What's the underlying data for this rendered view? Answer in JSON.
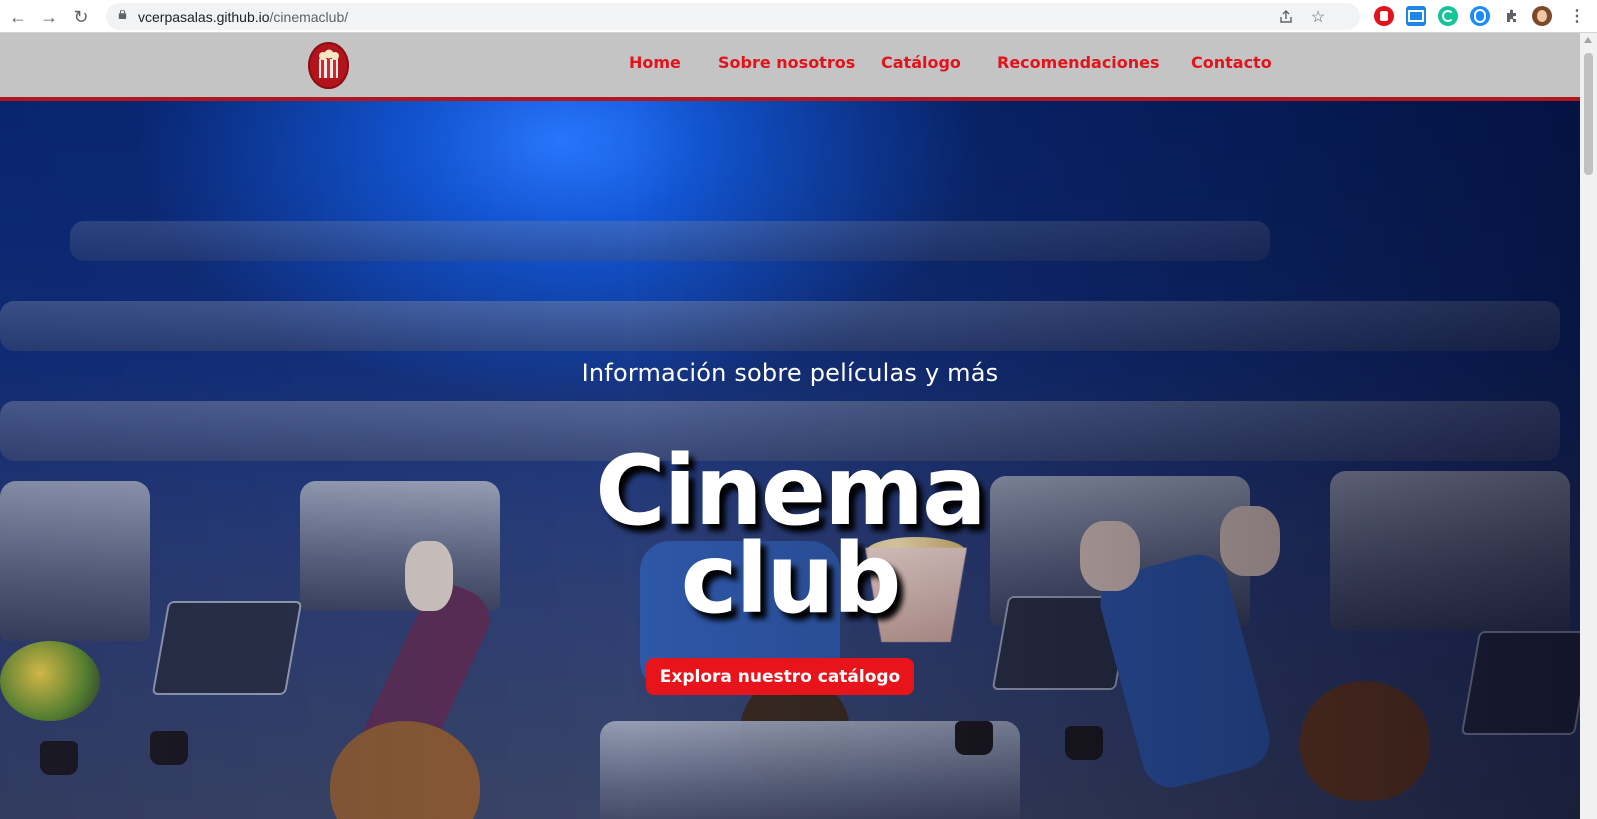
{
  "browser": {
    "url_host": "vcerpasalas.github.io",
    "url_path": "/cinemaclub/"
  },
  "site": {
    "nav": [
      {
        "label": "Home"
      },
      {
        "label": "Sobre nosotros"
      },
      {
        "label": "Catálogo"
      },
      {
        "label": "Recomendaciones"
      },
      {
        "label": "Contacto"
      }
    ],
    "accent_color": "#e3131b",
    "header_bg": "#c4c4c4",
    "header_border": "#b0171f"
  },
  "hero": {
    "tagline": "Información sobre películas y más",
    "title_line1": "Cinema",
    "title_line2": "club",
    "cta_label": "Explora nuestro catálogo",
    "cta_color": "#e8141c"
  }
}
